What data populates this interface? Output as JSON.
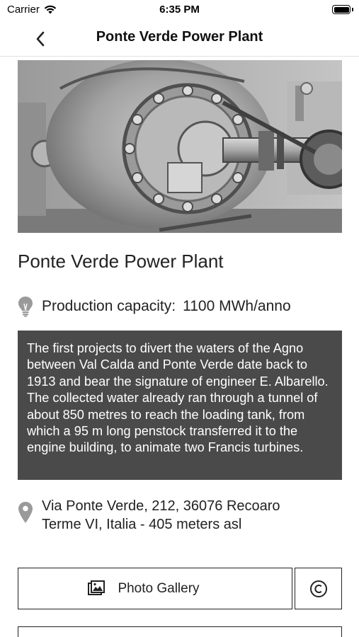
{
  "status_bar": {
    "carrier": "Carrier",
    "time": "6:35 PM"
  },
  "nav": {
    "title": "Ponte Verde Power Plant"
  },
  "place": {
    "title": "Ponte Verde Power Plant",
    "capacity_label": "Production capacity:",
    "capacity_value": "1100 MWh/anno",
    "description": "The first projects to divert the waters of the Agno between Val Calda and Ponte Verde date back to 1913 and bear the signature of engineer E. Albarello. The collected water already ran through a tunnel of about 850 metres to reach the loading tank, from which a 95 m long penstock transferred it to the engine building, to animate two Francis turbines.",
    "address_line1": "Via Ponte Verde, 212, 36076 Recoaro",
    "address_line2": "Terme VI, Italia - 405 meters asl"
  },
  "actions": {
    "gallery_label": "Photo Gallery"
  },
  "icons": {
    "back": "chevron-left-icon",
    "capacity": "lightbulb-icon",
    "address": "map-pin-icon",
    "gallery": "photo-gallery-icon",
    "copyright": "copyright-icon",
    "wifi": "wifi-icon",
    "battery": "battery-icon"
  },
  "colors": {
    "description_background": "#4a4a4a",
    "icon_gray": "#8a8a8a",
    "border": "#222222"
  }
}
